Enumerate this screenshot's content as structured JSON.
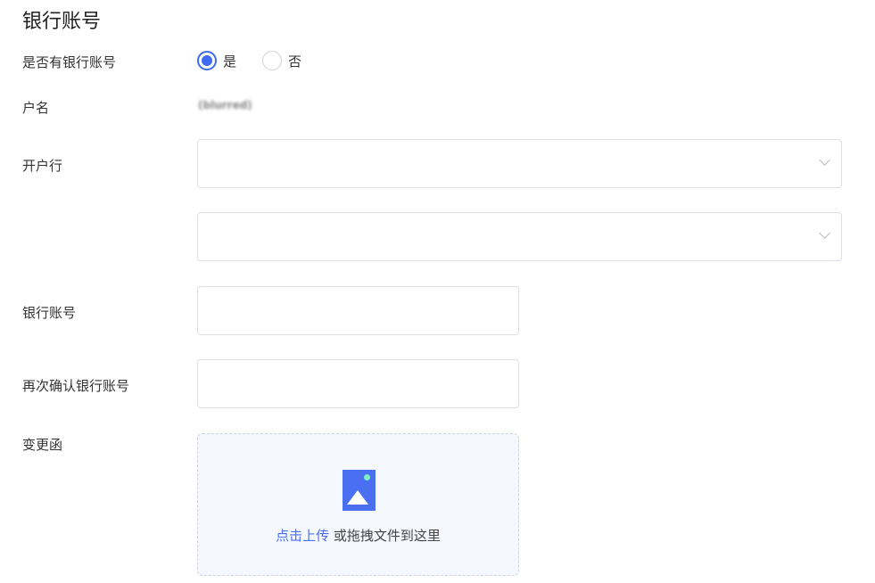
{
  "section_title": "银行账号",
  "has_account": {
    "label": "是否有银行账号",
    "options": [
      "是",
      "否"
    ],
    "selected": "是"
  },
  "account_name": {
    "label": "户名",
    "value": "(blurred)"
  },
  "bank": {
    "label": "开户行",
    "value": "",
    "sub_value": ""
  },
  "account_number": {
    "label": "银行账号",
    "value": ""
  },
  "confirm_account_number": {
    "label": "再次确认银行账号",
    "value": ""
  },
  "change_letter": {
    "label": "变更函",
    "upload_link": "点击上传",
    "upload_hint": "或拖拽文件到这里",
    "icon": "image-icon"
  },
  "colors": {
    "accent": "#3f6cf0"
  }
}
